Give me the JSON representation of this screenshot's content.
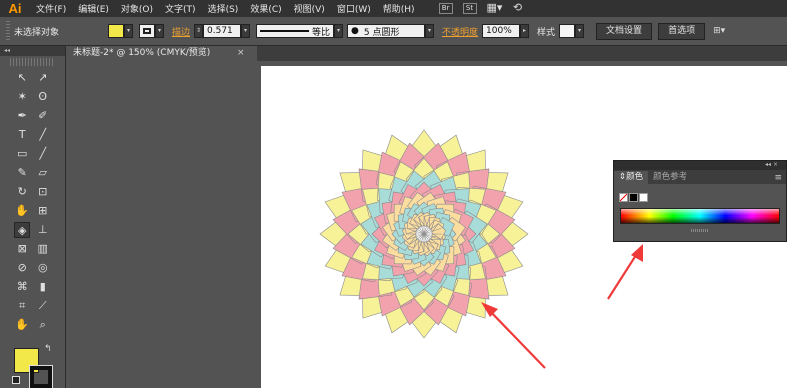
{
  "app": {
    "logo": "Ai"
  },
  "menu": [
    "文件(F)",
    "编辑(E)",
    "对象(O)",
    "文字(T)",
    "选择(S)",
    "效果(C)",
    "视图(V)",
    "窗口(W)",
    "帮助(H)"
  ],
  "menubar_icons": {
    "bridge": "Br",
    "stock": "St"
  },
  "control": {
    "selection_status": "未选择对象",
    "fill_color": "#f2e84a",
    "stroke_label": "描边",
    "stroke_weight": "0.571",
    "profile_label": "等比",
    "brush_label": "5 点圆形",
    "opacity_label": "不透明度",
    "opacity_value": "100%",
    "style_label": "样式",
    "doc_setup": "文档设置",
    "preferences": "首选项"
  },
  "document": {
    "tab_title": "未标题-2* @ 150% (CMYK/预览)",
    "close_glyph": "×"
  },
  "tools": [
    [
      "selection-tool",
      "direct-selection-tool"
    ],
    [
      "magic-wand-tool",
      "lasso-tool"
    ],
    [
      "pen-tool",
      "curvature-tool"
    ],
    [
      "type-tool",
      "line-segment-tool"
    ],
    [
      "rectangle-tool",
      "paintbrush-tool"
    ],
    [
      "pencil-tool",
      "eraser-tool"
    ],
    [
      "rotate-tool",
      "scale-tool"
    ],
    [
      "warp-tool",
      "free-transform-tool"
    ],
    [
      "shape-builder-tool",
      "perspective-grid-tool"
    ],
    [
      "mesh-tool",
      "gradient-tool"
    ],
    [
      "eyedropper-tool",
      "blend-tool"
    ],
    [
      "symbol-sprayer-tool",
      "column-graph-tool"
    ],
    [
      "artboard-tool",
      "slice-tool"
    ],
    [
      "hand-tool",
      "zoom-tool"
    ]
  ],
  "tool_glyphs": [
    [
      "↖",
      "↗"
    ],
    [
      "✶",
      "ʘ"
    ],
    [
      "✒",
      "✐"
    ],
    [
      "T",
      "╱"
    ],
    [
      "▭",
      "╱"
    ],
    [
      "✎",
      "▱"
    ],
    [
      "↻",
      "⊡"
    ],
    [
      "✋",
      "⊞"
    ],
    [
      "◈",
      "⊥"
    ],
    [
      "⊠",
      "▥"
    ],
    [
      "⊘",
      "◎"
    ],
    [
      "⌘",
      "▮"
    ],
    [
      "⌗",
      "⟋"
    ],
    [
      "✋",
      "⌕"
    ]
  ],
  "color_panel": {
    "tabs": [
      "颜色",
      "颜色参考"
    ],
    "menu_glyph": "≡",
    "spectrum": [
      "#ff0000",
      "#ffff00",
      "#00ff00",
      "#00ffff",
      "#0000ff",
      "#ff00ff",
      "#ff0000"
    ]
  },
  "flower": {
    "petal_colors": [
      "#f7f197",
      "#f2a2ad",
      "#a8dcd9",
      "#fbdda0"
    ]
  },
  "colors": {
    "arrow": "#f03a3a",
    "accent_link": "#f0a030"
  }
}
